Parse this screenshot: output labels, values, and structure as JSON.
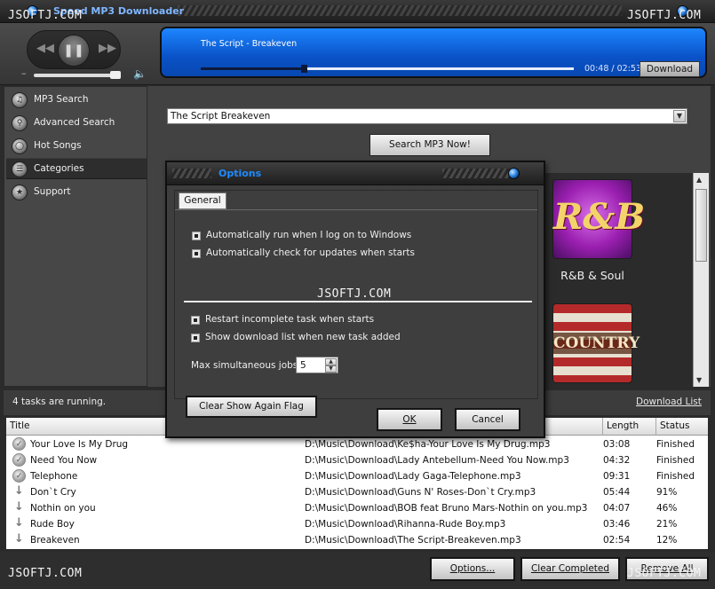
{
  "app": {
    "title": "Speed MP3 Downloader"
  },
  "watermark": "JSOFTJ.COM",
  "player": {
    "controls": {
      "prev": "prev-icon",
      "play": "pause-icon",
      "next": "next-icon",
      "volume": "speaker-icon"
    },
    "volume_level": 0.95,
    "now_playing": "The Script - Breakeven",
    "progress": 0.275,
    "time": "00:48 / 02:53",
    "download_label": "Download"
  },
  "sidebar": {
    "items": [
      {
        "label": "MP3 Search",
        "icon": "search-icon"
      },
      {
        "label": "Advanced Search",
        "icon": "advanced-search-icon"
      },
      {
        "label": "Hot Songs",
        "icon": "headphones-icon"
      },
      {
        "label": "Categories",
        "icon": "categories-icon",
        "active": true
      },
      {
        "label": "Support",
        "icon": "star-icon"
      }
    ]
  },
  "search": {
    "query": "The Script Breakeven",
    "button_label": "Search MP3 Now!"
  },
  "categories": [
    {
      "label": "R&B & Soul",
      "art_text": "R&B"
    },
    {
      "label": "",
      "art_text": "COUNTRY"
    }
  ],
  "status": {
    "tasks_text": "4 tasks are running.",
    "download_list_link": "Download List"
  },
  "table": {
    "columns": [
      "Title",
      "Length",
      "Status"
    ],
    "rows": [
      {
        "state": "finished",
        "title": "Your Love Is My Drug",
        "path": "D:\\Music\\Download\\Ke$ha-Your Love Is My Drug.mp3",
        "length": "03:08",
        "status": "Finished"
      },
      {
        "state": "finished",
        "title": "Need You Now",
        "path": "D:\\Music\\Download\\Lady Antebellum-Need You Now.mp3",
        "length": "04:32",
        "status": "Finished"
      },
      {
        "state": "finished",
        "title": "Telephone",
        "path": "D:\\Music\\Download\\Lady Gaga-Telephone.mp3",
        "length": "09:31",
        "status": "Finished"
      },
      {
        "state": "downloading",
        "title": "Don`t Cry",
        "path": "D:\\Music\\Download\\Guns N' Roses-Don`t Cry.mp3",
        "length": "05:44",
        "status": "91%"
      },
      {
        "state": "downloading",
        "title": "Nothin on you",
        "path": "D:\\Music\\Download\\BOB feat Bruno Mars-Nothin on you.mp3",
        "length": "04:07",
        "status": "46%"
      },
      {
        "state": "downloading",
        "title": "Rude Boy",
        "path": "D:\\Music\\Download\\Rihanna-Rude Boy.mp3",
        "length": "03:46",
        "status": "21%"
      },
      {
        "state": "downloading",
        "title": "Breakeven",
        "path": "D:\\Music\\Download\\The Script-Breakeven.mp3",
        "length": "02:54",
        "status": "12%"
      }
    ]
  },
  "bottom": {
    "options_label": "Options...",
    "clear_completed_label": "Clear Completed",
    "remove_all_label": "Remove All"
  },
  "dialog": {
    "title": "Options",
    "tab_general": "General",
    "options": [
      {
        "label": "Automatically run when I log on to Windows",
        "checked": true
      },
      {
        "label": "Automatically check for updates when starts",
        "checked": true
      },
      {
        "label": "Restart incomplete task when starts",
        "checked": true
      },
      {
        "label": "Show download list when new task added",
        "checked": true
      }
    ],
    "max_jobs_label": "Max simultaneous jobs",
    "max_jobs_value": "5",
    "clear_flag_label": "Clear Show Again Flag",
    "ok_label": "OK",
    "cancel_label": "Cancel"
  },
  "colors": {
    "now_playing_bg": "#0a5ad0",
    "dialog_title": "#1e8bff",
    "app_title": "#7fb6ff"
  }
}
